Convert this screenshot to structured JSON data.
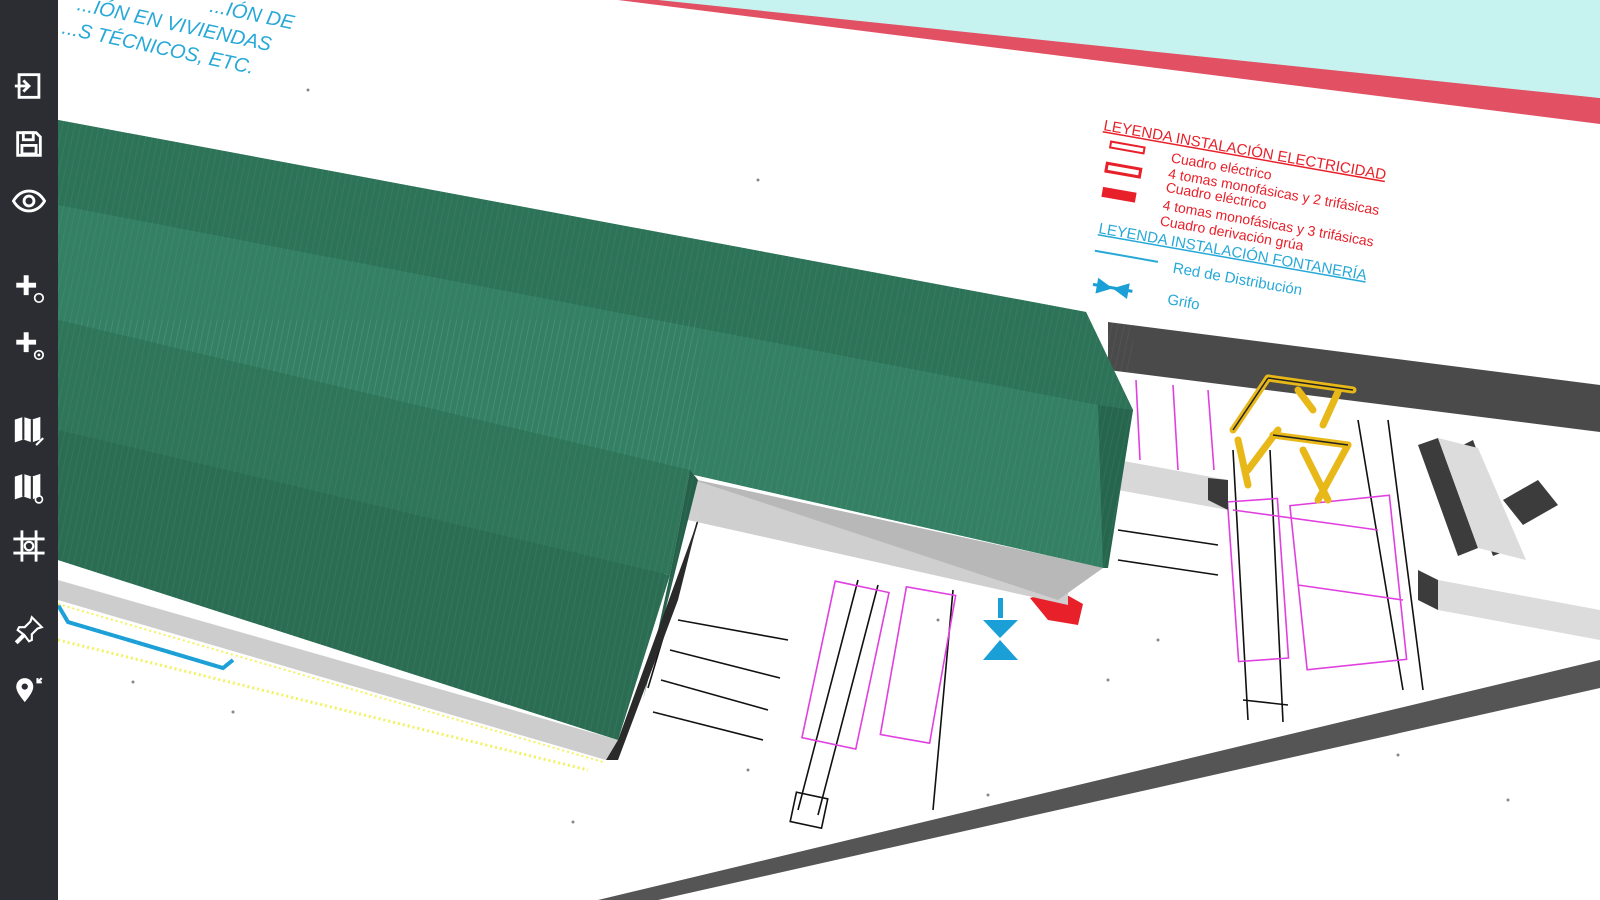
{
  "app": {
    "toolbar": {
      "buttons": [
        {
          "name": "import-button",
          "icon": "import-icon"
        },
        {
          "name": "save-button",
          "icon": "save-icon"
        },
        {
          "name": "view-button",
          "icon": "eye-icon"
        },
        {
          "name": "add-element-button",
          "icon": "add-element-icon"
        },
        {
          "name": "add-group-button",
          "icon": "add-group-icon"
        },
        {
          "name": "map-edit-button",
          "icon": "map-edit-icon"
        },
        {
          "name": "map-view-button",
          "icon": "map-view-icon"
        },
        {
          "name": "grid-button",
          "icon": "grid-icon"
        },
        {
          "name": "pin-button",
          "icon": "pin-icon"
        },
        {
          "name": "locate-button",
          "icon": "location-icon"
        }
      ]
    },
    "colors": {
      "toolbar_bg": "#2b2d33",
      "roof_green": "#2f7a5e",
      "legend_red": "#e8202a",
      "legend_blue": "#1a9fd6",
      "crane_yellow": "#f0c020",
      "magenta_lines": "#e040e0",
      "sky_cyan": "#c6f3f0"
    }
  },
  "drawing": {
    "notes_line1": "...IÓN EN VIVIENDAS",
    "notes_line2": "...S TÉCNICOS, ETC.",
    "notes_line_top": "...IÓN DE",
    "legend_electric": {
      "title": "LEYENDA INSTALACIÓN ELECTRICIDAD",
      "items": [
        "Cuadro eléctrico",
        "4 tomas monofásicas y 2 trifásicas",
        "Cuadro eléctrico",
        "4 tomas monofásicas y 3 trifásicas",
        "Cuadro derivación grúa"
      ]
    },
    "legend_water": {
      "title": "LEYENDA INSTALACIÓN FONTANERÍA",
      "items": [
        "Red de Distribución",
        "Grifo"
      ]
    }
  }
}
